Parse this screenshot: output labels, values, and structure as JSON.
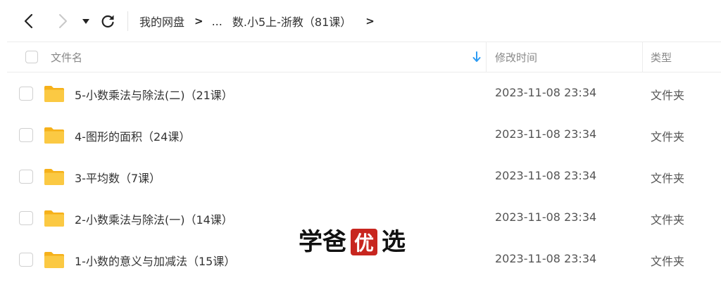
{
  "toolbar": {
    "back_icon": "chevron-left-icon",
    "forward_icon": "chevron-right-icon",
    "dropdown_icon": "caret-down-icon",
    "refresh_icon": "refresh-icon"
  },
  "breadcrumb": {
    "root": "我的网盘",
    "separator": ">",
    "ellipsis": "...",
    "current": "数.小5上-浙教（81课）",
    "end_separator": ">"
  },
  "table": {
    "header": {
      "name": "文件名",
      "modified": "修改时间",
      "type": "类型",
      "sort_icon": "arrow-down-icon",
      "sort_color": "#2b9bf4"
    },
    "rows": [
      {
        "name": "5-小数乘法与除法(二)（21课）",
        "modified": "2023-11-08 23:34",
        "type": "文件夹"
      },
      {
        "name": "4-图形的面积（24课）",
        "modified": "2023-11-08 23:34",
        "type": "文件夹"
      },
      {
        "name": "3-平均数（7课）",
        "modified": "2023-11-08 23:34",
        "type": "文件夹"
      },
      {
        "name": "2-小数乘法与除法(一)（14课）",
        "modified": "2023-11-08 23:34",
        "type": "文件夹"
      },
      {
        "name": "1-小数的意义与加减法（15课）",
        "modified": "2023-11-08 23:34",
        "type": "文件夹"
      }
    ]
  },
  "colors": {
    "folder": "#fbc02d",
    "folder_dark": "#f6b11a",
    "seal": "#c8261f"
  },
  "watermark": {
    "c1": "学",
    "c2": "爸",
    "c3": "优",
    "c4": "选"
  }
}
